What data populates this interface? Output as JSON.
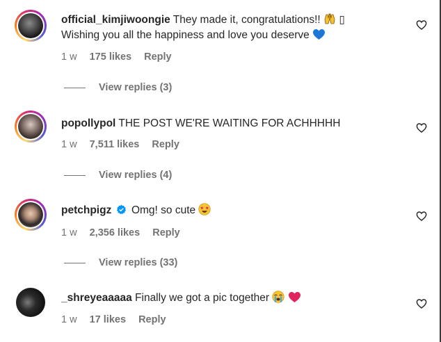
{
  "comments": [
    {
      "username": "official_kimjiwoongie",
      "text_line1": "They made it, congratulations!!",
      "tofu": "▯",
      "text_line2": "Wishing you all the happiness and love you deserve",
      "age": "1 w",
      "likes": "175 likes",
      "reply": "Reply",
      "view_replies": "View replies (3)",
      "avatar_ring": true,
      "emojis": [
        "raising-hands-emoji",
        "blue-heart-emoji"
      ]
    },
    {
      "username": "popollypol",
      "text_line1": "THE POST WE'RE WAITING FOR ACHHHHH",
      "age": "1 w",
      "likes": "7,511 likes",
      "reply": "Reply",
      "view_replies": "View replies (4)",
      "avatar_ring": true
    },
    {
      "username": "petchpigz",
      "verified": true,
      "text_line1": "Omg! so cute",
      "age": "1 w",
      "likes": "2,356 likes",
      "reply": "Reply",
      "view_replies": "View replies (33)",
      "avatar_ring": true,
      "emojis": [
        "star-struck-emoji"
      ]
    },
    {
      "username": "_shreyeaaaaa",
      "text_line1": "Finally we got a pic together",
      "age": "1 w",
      "likes": "17 likes",
      "reply": "Reply",
      "avatar_ring": false,
      "emojis": [
        "crying-face-emoji",
        "red-heart-emoji"
      ]
    }
  ],
  "colors": {
    "text": "#262626",
    "secondary": "#737373",
    "verified_blue": "#0095f6",
    "heart_red": "#e0245e",
    "blue_heart": "#1d77d6"
  },
  "icons": [
    "heart-outline-icon",
    "verified-badge-icon"
  ]
}
